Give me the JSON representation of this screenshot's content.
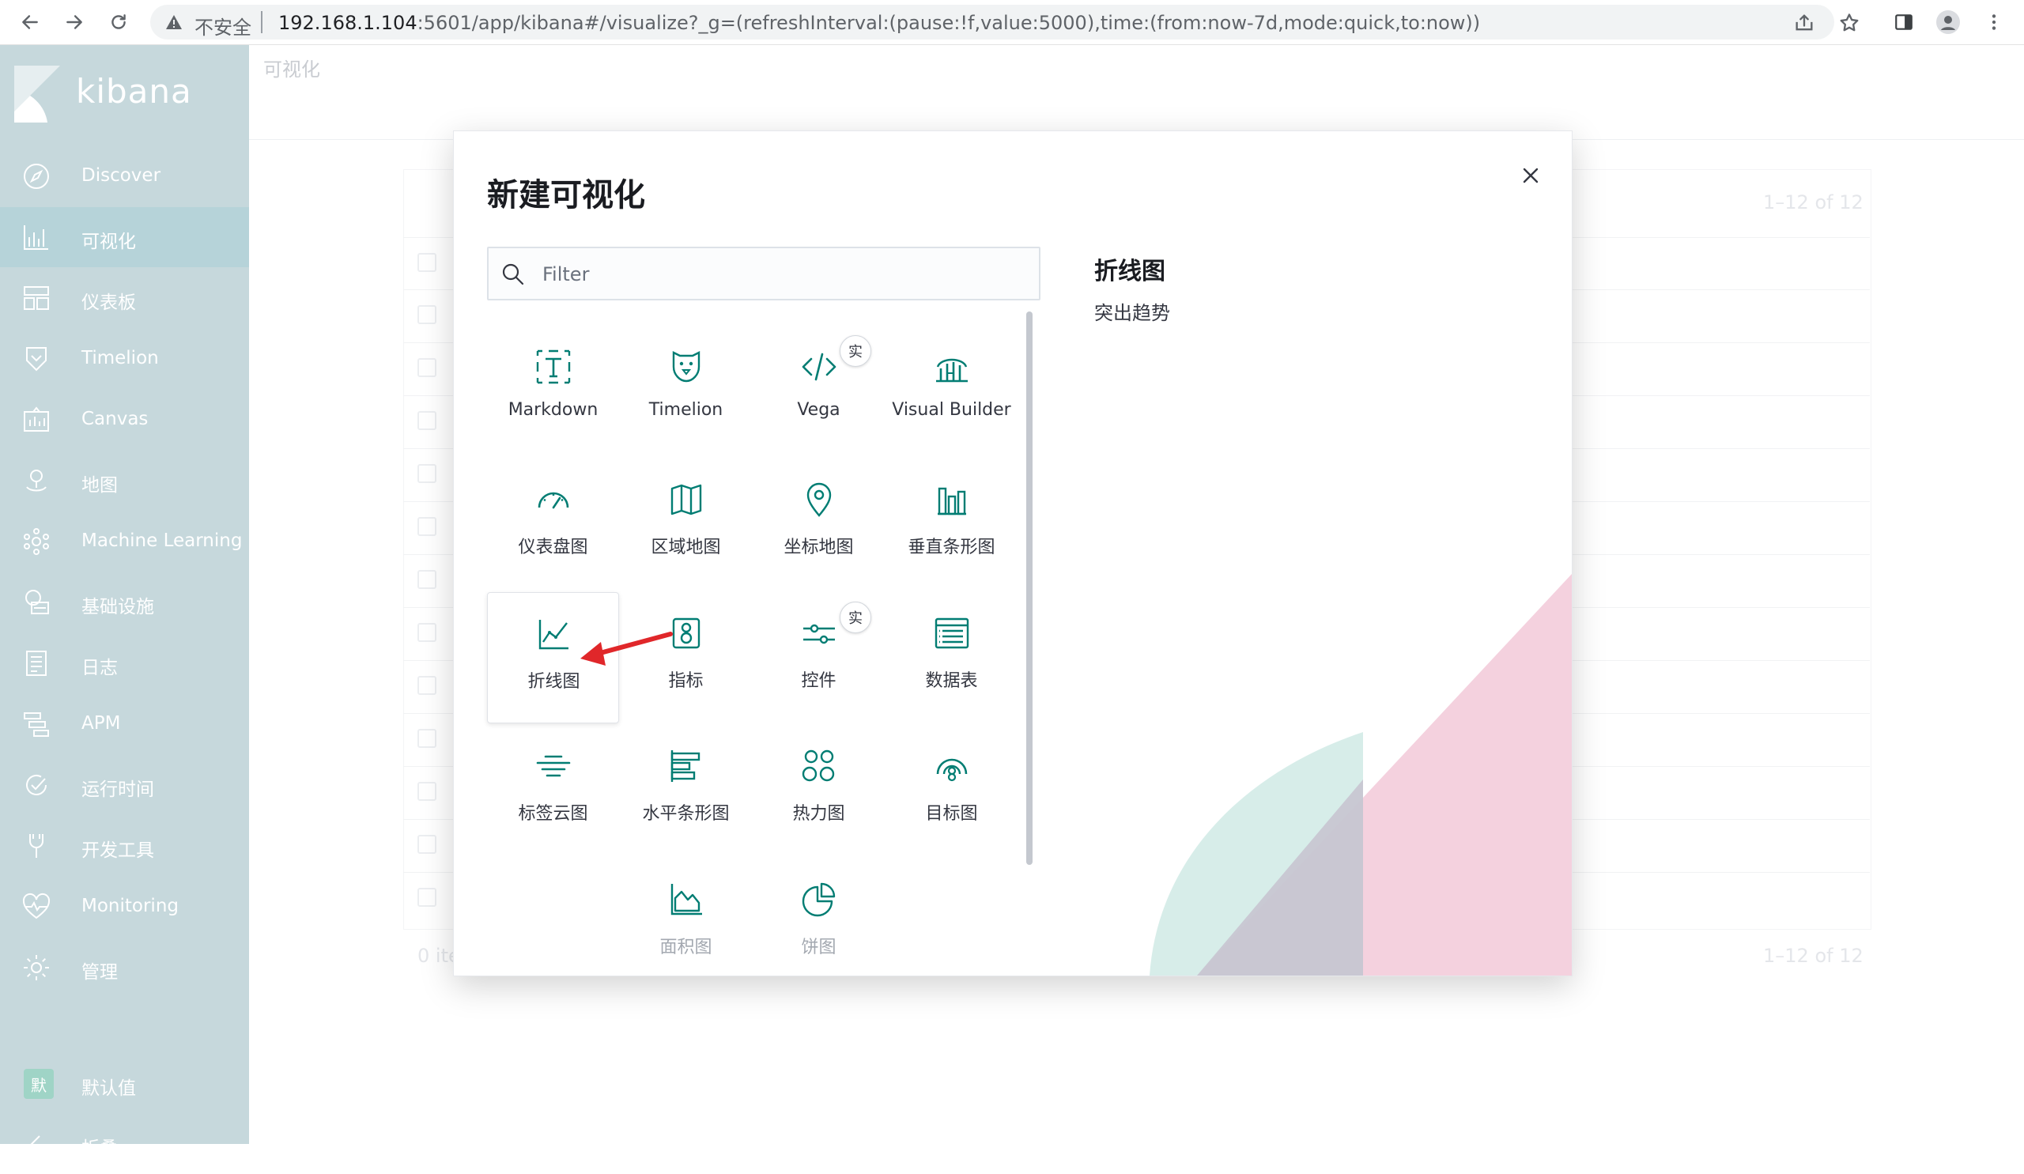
{
  "browser": {
    "security_label": "不安全",
    "url_host": "192.168.1.104",
    "url_rest": ":5601/app/kibana#/visualize?_g=(refreshInterval:(pause:!f,value:5000),time:(from:now-7d,mode:quick,to:now))"
  },
  "sidebar": {
    "logo_text": "kibana",
    "items": [
      {
        "label": "Discover",
        "icon": "compass-icon"
      },
      {
        "label": "可视化",
        "icon": "visualize-icon"
      },
      {
        "label": "仪表板",
        "icon": "dashboard-icon"
      },
      {
        "label": "Timelion",
        "icon": "timelion-icon"
      },
      {
        "label": "Canvas",
        "icon": "canvas-icon"
      },
      {
        "label": "地图",
        "icon": "maps-icon"
      },
      {
        "label": "Machine Learning",
        "icon": "ml-icon"
      },
      {
        "label": "基础设施",
        "icon": "infrastructure-icon"
      },
      {
        "label": "日志",
        "icon": "logs-icon"
      },
      {
        "label": "APM",
        "icon": "apm-icon"
      },
      {
        "label": "运行时间",
        "icon": "uptime-icon"
      },
      {
        "label": "开发工具",
        "icon": "devtools-icon"
      },
      {
        "label": "Monitoring",
        "icon": "monitoring-icon"
      },
      {
        "label": "管理",
        "icon": "gear-icon"
      }
    ],
    "space_badge": "默",
    "space_label": "默认值",
    "collapse_label": "折叠"
  },
  "page": {
    "breadcrumb": "可视化",
    "pager_top": "1–12 of 12",
    "pager_bottom": "1–12 of 12",
    "items_count": "0 ite"
  },
  "modal": {
    "title": "新建可视化",
    "filter_placeholder": "Filter",
    "experimental_badge": "实",
    "types": [
      {
        "label": "Markdown",
        "icon": "markdown-icon"
      },
      {
        "label": "Timelion",
        "icon": "timelion-icon"
      },
      {
        "label": "Vega",
        "icon": "code-icon"
      },
      {
        "label": "Visual Builder",
        "icon": "visual-builder-icon"
      },
      {
        "label": "仪表盘图",
        "icon": "gauge-icon"
      },
      {
        "label": "区域地图",
        "icon": "region-map-icon"
      },
      {
        "label": "坐标地图",
        "icon": "map-pin-icon"
      },
      {
        "label": "垂直条形图",
        "icon": "vertical-bar-icon"
      },
      {
        "label": "折线图",
        "icon": "line-chart-icon"
      },
      {
        "label": "指标",
        "icon": "metric-icon"
      },
      {
        "label": "控件",
        "icon": "controls-icon"
      },
      {
        "label": "数据表",
        "icon": "table-icon"
      },
      {
        "label": "标签云图",
        "icon": "tag-cloud-icon"
      },
      {
        "label": "水平条形图",
        "icon": "horizontal-bar-icon"
      },
      {
        "label": "热力图",
        "icon": "heatmap-icon"
      },
      {
        "label": "目标图",
        "icon": "goal-icon"
      },
      {
        "label": "面积图",
        "icon": "area-chart-icon"
      },
      {
        "label": "饼图",
        "icon": "pie-chart-icon"
      }
    ],
    "selected_title": "折线图",
    "selected_description": "突出趋势"
  },
  "colors": {
    "accent": "#017d73",
    "sidebar_bg": "#c6d8dc",
    "annotation_arrow": "#e0272a"
  }
}
